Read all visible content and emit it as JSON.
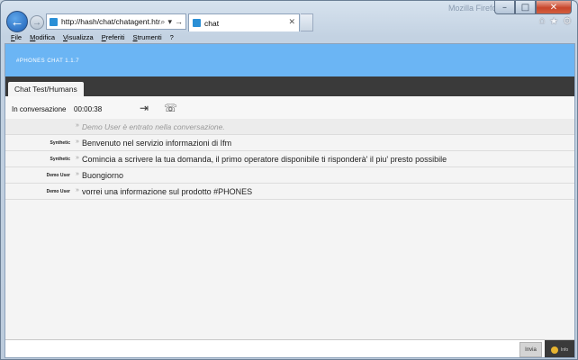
{
  "browser": {
    "window_title_ghost": "Mozilla Firefox",
    "address": "http://hash/chat/chatagent.htm",
    "tab_title": "chat",
    "colors": {
      "frame": "#c3d2e2",
      "back_button": "#1d5fb5"
    }
  },
  "menubar": {
    "items": [
      "File",
      "Modifica",
      "Visualizza",
      "Preferiti",
      "Strumenti",
      "?"
    ]
  },
  "app": {
    "title": "#PHONES CHAT 1.1.7",
    "header_color": "#6bb5f4",
    "tab_label": "Chat Test/Humans",
    "status_label": "In conversazione",
    "timer": "00:00:38",
    "send_label": "Invia",
    "emoji_label": "Info"
  },
  "messages": [
    {
      "sender": "",
      "text": "Demo User è entrato nella conversazione.",
      "system": true
    },
    {
      "sender": "Synthetic",
      "text": "Benvenuto nel servizio informazioni di Ifm"
    },
    {
      "sender": "Synthetic",
      "text": "Comincia a scrivere la tua domanda, il primo operatore disponibile ti risponderà' il piu' presto possibile"
    },
    {
      "sender": "Demo User",
      "text": "Buongiorno"
    },
    {
      "sender": "Demo User",
      "text": "vorrei una informazione sul prodotto #PHONES"
    }
  ]
}
